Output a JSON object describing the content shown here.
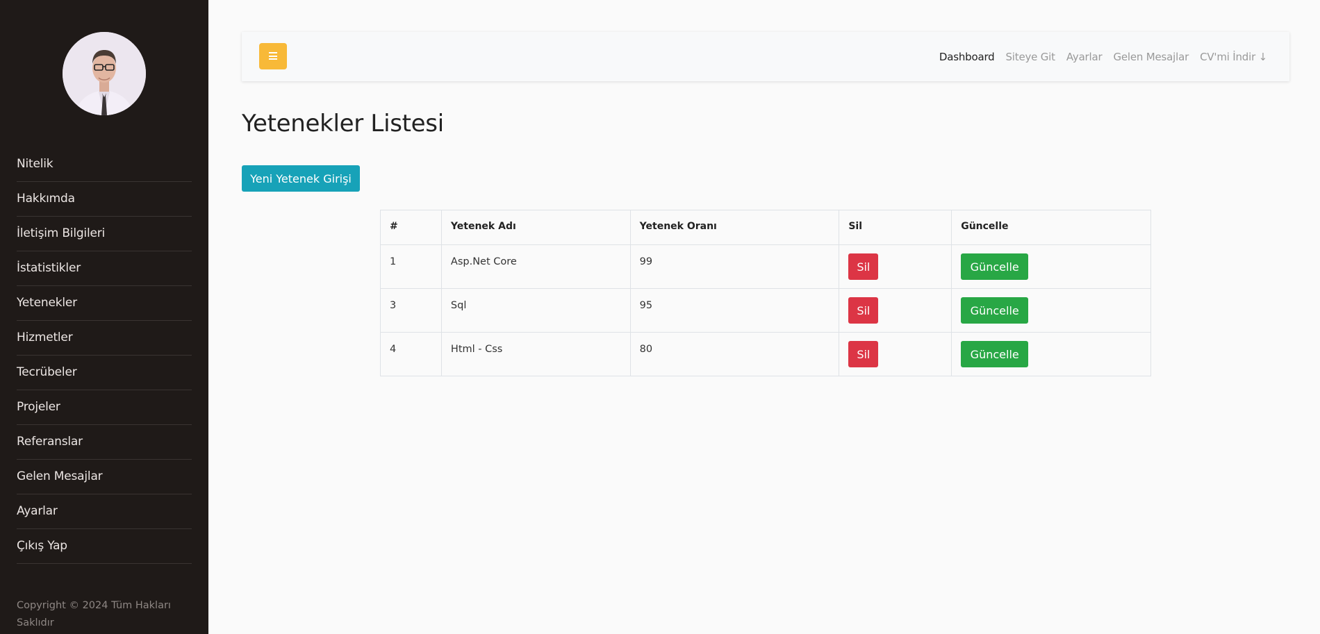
{
  "sidebar": {
    "nav": [
      {
        "label": "Nitelik"
      },
      {
        "label": "Hakkımda"
      },
      {
        "label": "İletişim Bilgileri"
      },
      {
        "label": "İstatistikler"
      },
      {
        "label": "Yetenekler"
      },
      {
        "label": "Hizmetler"
      },
      {
        "label": "Tecrübeler"
      },
      {
        "label": "Projeler"
      },
      {
        "label": "Referanslar"
      },
      {
        "label": "Gelen Mesajlar"
      },
      {
        "label": "Ayarlar"
      },
      {
        "label": "Çıkış Yap"
      }
    ],
    "copyright": "Copyright © 2024 Tüm Hakları Saklıdır"
  },
  "topbar": {
    "links": [
      {
        "label": "Dashboard",
        "active": true
      },
      {
        "label": "Siteye Git"
      },
      {
        "label": "Ayarlar"
      },
      {
        "label": "Gelen Mesajlar"
      },
      {
        "label": "CV'mi İndir ↓"
      }
    ]
  },
  "main": {
    "title": "Yetenekler Listesi",
    "new_button": "Yeni Yetenek Girişi",
    "table": {
      "headers": [
        "#",
        "Yetenek Adı",
        "Yetenek Oranı",
        "Sil",
        "Güncelle"
      ],
      "rows": [
        {
          "id": "1",
          "name": "Asp.Net Core",
          "rate": "99",
          "delete_label": "Sil",
          "update_label": "Güncelle"
        },
        {
          "id": "3",
          "name": "Sql",
          "rate": "95",
          "delete_label": "Sil",
          "update_label": "Güncelle"
        },
        {
          "id": "4",
          "name": "Html - Css",
          "rate": "80",
          "delete_label": "Sil",
          "update_label": "Güncelle"
        }
      ]
    }
  },
  "colors": {
    "sidebar_bg": "#1f1a18",
    "toggle": "#f8b938",
    "primary": "#17a2b8",
    "danger": "#dc3545",
    "success": "#28a745"
  }
}
